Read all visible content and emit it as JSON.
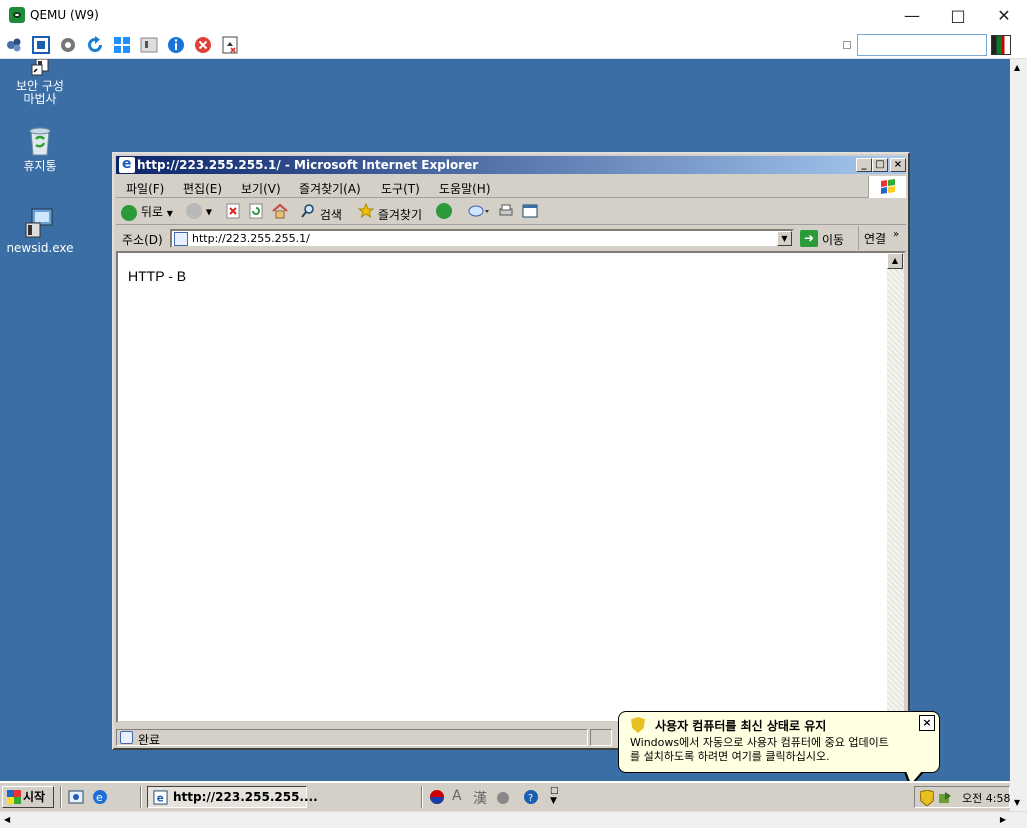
{
  "host": {
    "title": "QEMU (W9)",
    "search_value": ""
  },
  "desktop": {
    "icons": [
      {
        "label_line1": "보안 구성",
        "label_line2": "마법사"
      },
      {
        "label_line1": "휴지통",
        "label_line2": ""
      },
      {
        "label_line1": "newsid.exe",
        "label_line2": ""
      }
    ]
  },
  "ie": {
    "title": "http://223.255.255.1/ - Microsoft Internet Explorer",
    "menu": [
      "파일(F)",
      "편집(E)",
      "보기(V)",
      "즐겨찾기(A)",
      "도구(T)",
      "도움말(H)"
    ],
    "toolbar": {
      "back": "뒤로",
      "search": "검색",
      "favorites": "즐겨찾기"
    },
    "address_label": "주소(D)",
    "address_value": "http://223.255.255.1/",
    "go_label": "이동",
    "links_label": "연결",
    "page_text": "HTTP - B",
    "status_text": "완료"
  },
  "balloon": {
    "title": "사용자 컴퓨터를 최신 상태로 유지",
    "line1": "Windows에서 자동으로 사용자 컴퓨터에 중요 업데이트",
    "line2": "를 설치하도록 하려면 여기를 클릭하십시오.",
    "close": "×"
  },
  "taskbar": {
    "start_label": "시작",
    "task_label": "http://223.255.255....",
    "clock": "오전 4:58",
    "lang_a": "A",
    "lang_han": "漢"
  },
  "colors": {
    "desktop": "#3a6ea5",
    "title_gradient_start": "#0a246a",
    "title_gradient_end": "#a6caf0",
    "balloon_bg": "#ffffe1"
  }
}
